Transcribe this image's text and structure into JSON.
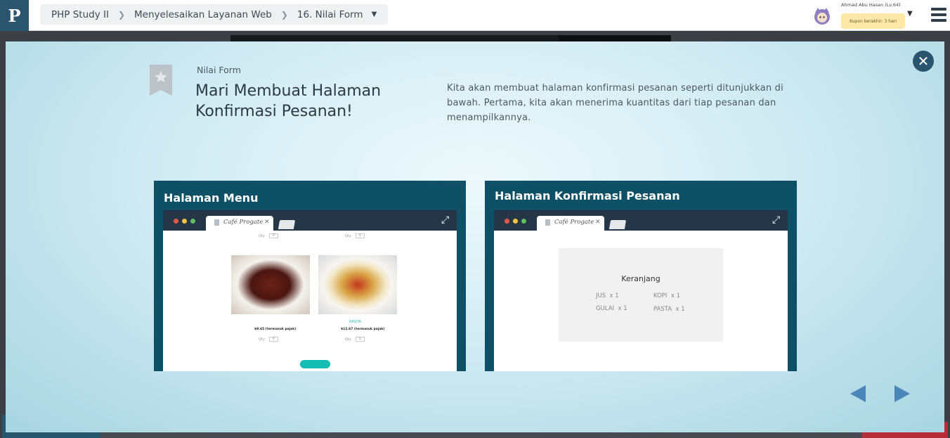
{
  "header": {
    "logo_icon": "progate-logo",
    "breadcrumb": [
      "PHP Study II",
      "Menyelesaikan Layanan Web",
      "16. Nilai Form"
    ],
    "user_name": "Ahmad Abu Hasan (Lv.64)",
    "coupon_text": "Kupon berakhir: 3 hari"
  },
  "modal": {
    "label": "Nilai Form",
    "title_line1": "Mari Membuat Halaman",
    "title_line2": "Konfirmasi Pesanan!",
    "description": "Kita akan membuat halaman konfirmasi pesanan seperti ditunjukkan di bawah. Pertama, kita akan menerima kuantitas dari tiap pesanan dan menampilkannya."
  },
  "menu_card": {
    "title": "Halaman Menu",
    "tab_label": "Café Progate",
    "qty_label": "Qty",
    "qty_value": "0",
    "food_name": "PASTA",
    "price_left": "$9.65 (termasuk pajak)",
    "price_right": "$12.67 (termasuk pajak)"
  },
  "confirm_card": {
    "title": "Halaman Konfirmasi Pesanan",
    "tab_label": "Café Progate",
    "cart_title": "Keranjang",
    "items": [
      {
        "name": "JUS",
        "qty_text": "x 1"
      },
      {
        "name": "KOPI",
        "qty_text": "x 1"
      },
      {
        "name": "GULAI",
        "qty_text": "x 1"
      },
      {
        "name": "PASTA",
        "qty_text": "x 1"
      }
    ]
  },
  "colors": {
    "brand_dark": "#2b546e",
    "card_bg": "#0e5166",
    "accent_teal": "#16bdb4",
    "arrow_blue": "#4a86b8"
  }
}
